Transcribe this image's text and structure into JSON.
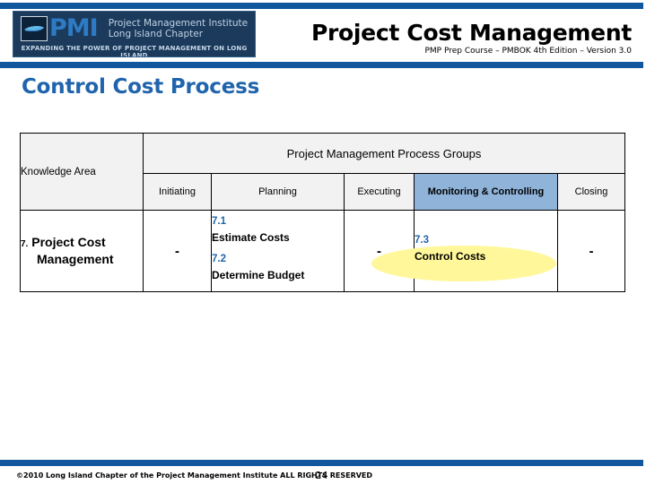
{
  "header": {
    "logo": {
      "acronym": "PMI",
      "org_line1": "Project Management Institute",
      "org_line2": "Long Island Chapter",
      "tagline": "EXPANDING THE POWER OF PROJECT MANAGEMENT ON LONG ISLAND"
    },
    "title": "Project Cost Management",
    "subtitle": "PMP Prep Course – PMBOK 4th Edition – Version 3.0",
    "rule_color": "#10579E"
  },
  "slide": {
    "title": "Control Cost Process",
    "title_color": "#1F64AC"
  },
  "matrix": {
    "knowledge_area_header": "Knowledge Area",
    "group_header": "Project Management Process Groups",
    "columns": [
      {
        "label": "Initiating",
        "highlighted": false
      },
      {
        "label": "Planning",
        "highlighted": false
      },
      {
        "label": "Executing",
        "highlighted": false
      },
      {
        "label": "Monitoring & Controlling",
        "highlighted": true
      },
      {
        "label": "Closing",
        "highlighted": false
      }
    ],
    "highlight_color": "#8FB3D9",
    "emphasis_color": "#FFF799",
    "row": {
      "number": "7.",
      "name_line1": "Project Cost",
      "name_line2": "Management",
      "initiating": "-",
      "planning": [
        {
          "number": "7.1",
          "name": "Estimate Costs"
        },
        {
          "number": "7.2",
          "name": "Determine Budget"
        }
      ],
      "executing": "-",
      "monitoring": [
        {
          "number": "7.3",
          "name": "Control Costs"
        }
      ],
      "closing": "-"
    }
  },
  "footer": {
    "copyright": "©2010 Long Island Chapter of the Project Management Institute  ALL RIGHTS RESERVED",
    "page_number": "24"
  }
}
